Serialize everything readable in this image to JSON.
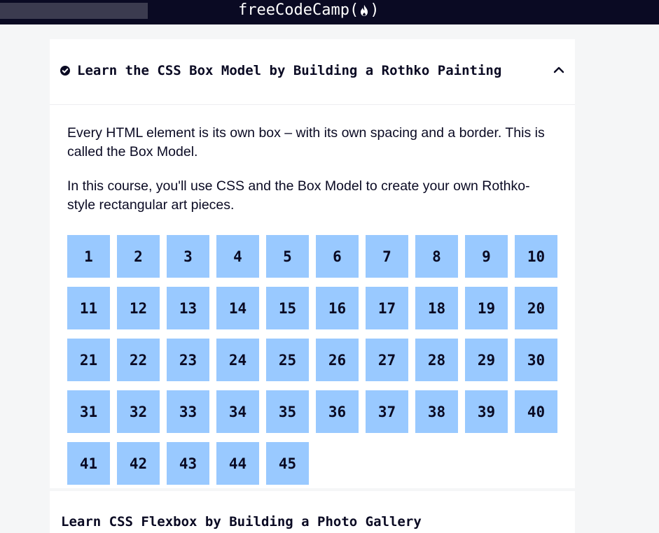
{
  "navbar": {
    "brand_prefix": "freeCodeCamp(",
    "brand_suffix": ")",
    "background": "#0a0a23"
  },
  "block": {
    "title": "Learn the CSS Box Model by Building a Rothko Painting",
    "completed": true,
    "expanded": true,
    "description": [
      "Every HTML element is its own box – with its own spacing and a border. This is called the Box Model.",
      "In this course, you'll use CSS and the Box Model to create your own Rothko-style rectangular art pieces."
    ],
    "steps": [
      "1",
      "2",
      "3",
      "4",
      "5",
      "6",
      "7",
      "8",
      "9",
      "10",
      "11",
      "12",
      "13",
      "14",
      "15",
      "16",
      "17",
      "18",
      "19",
      "20",
      "21",
      "22",
      "23",
      "24",
      "25",
      "26",
      "27",
      "28",
      "29",
      "30",
      "31",
      "32",
      "33",
      "34",
      "35",
      "36",
      "37",
      "38",
      "39",
      "40",
      "41",
      "42",
      "43",
      "44",
      "45"
    ]
  },
  "next_block": {
    "title": "Learn CSS Flexbox by Building a Photo Gallery"
  },
  "colors": {
    "step_bg": "#99c9ff",
    "text": "#0a0a23",
    "page_bg": "#f5f6f7"
  }
}
